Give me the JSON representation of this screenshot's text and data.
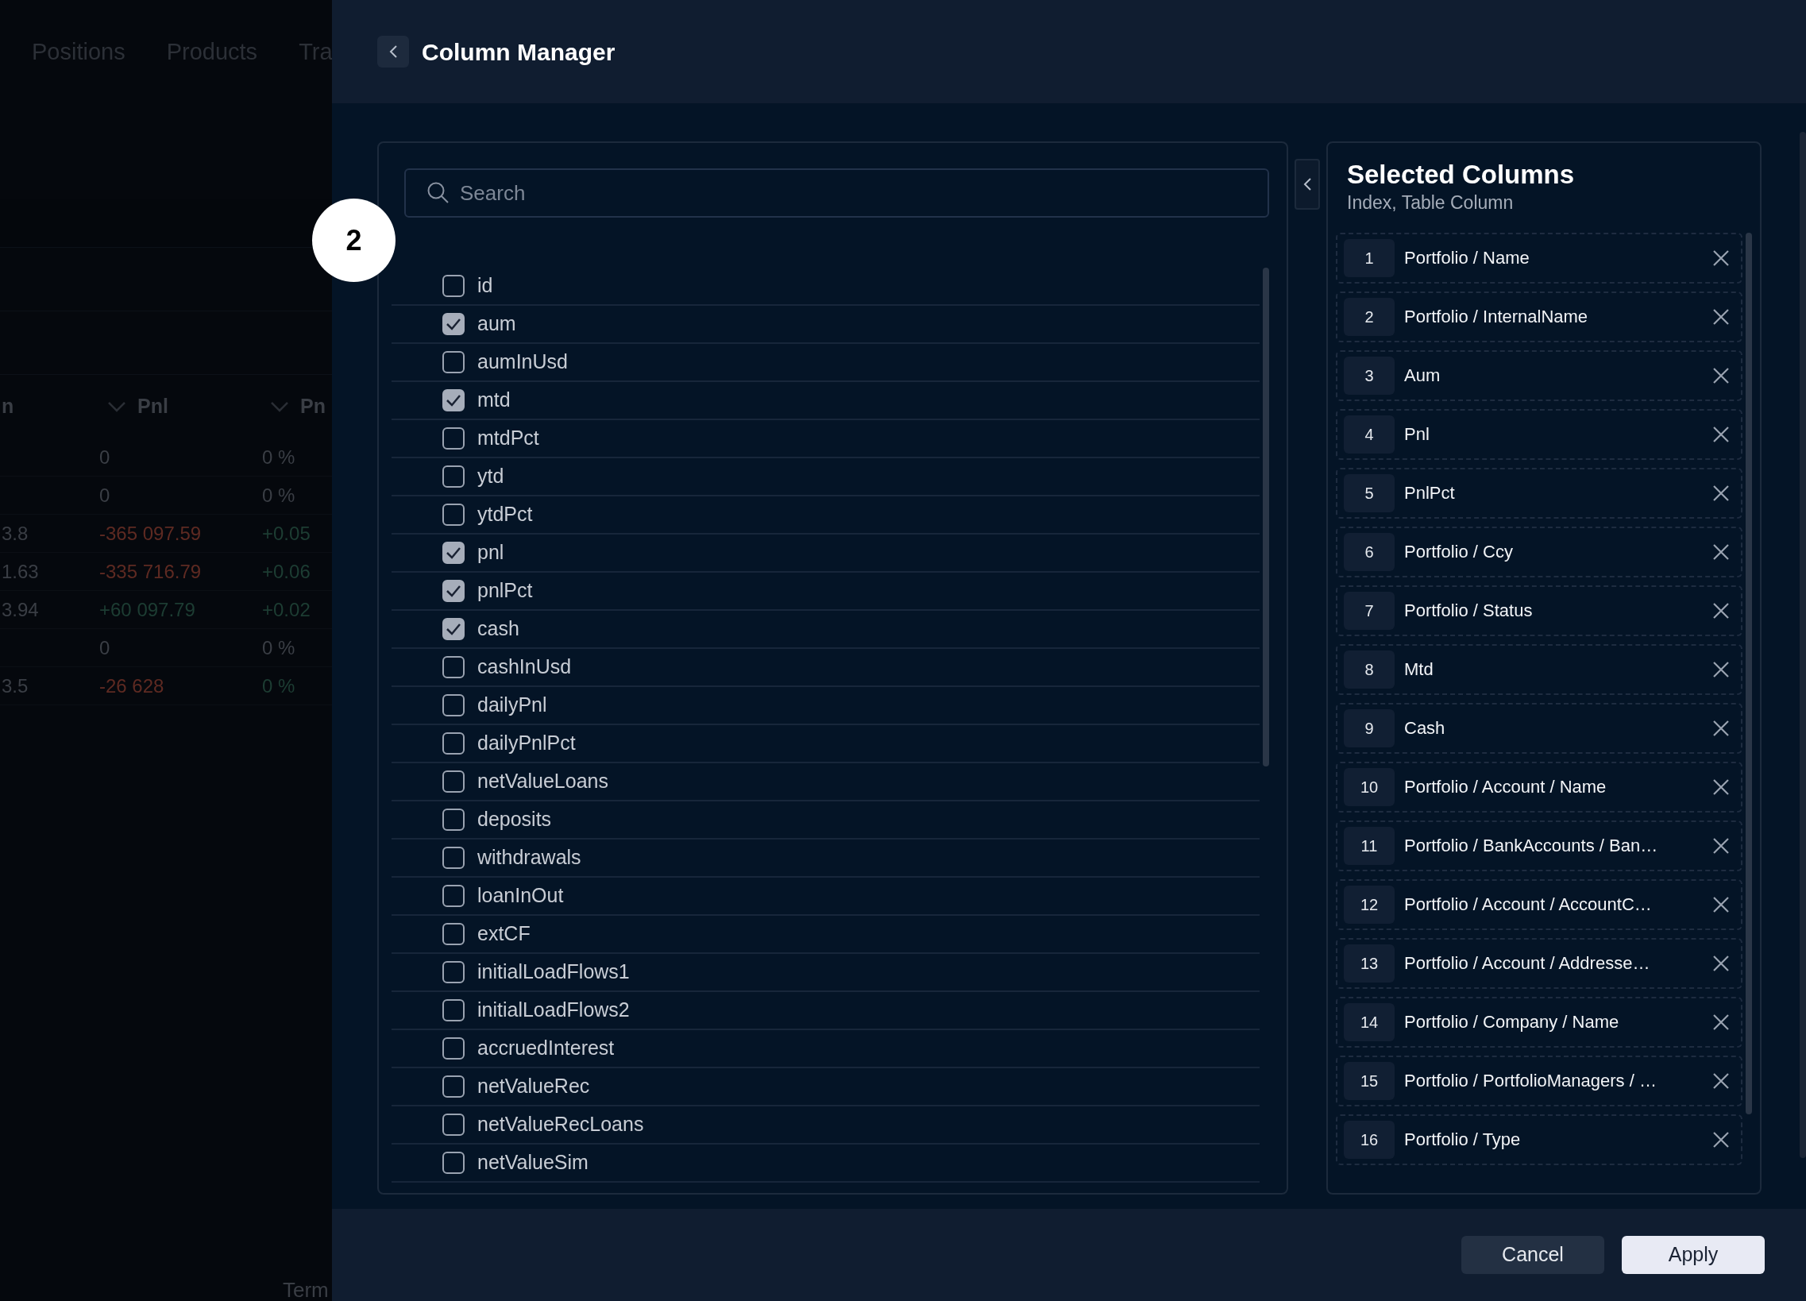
{
  "background": {
    "nav": [
      "Positions",
      "Products",
      "Tra"
    ],
    "table": {
      "columns": [
        {
          "label": "n",
          "chevron": false
        },
        {
          "label": "Pnl",
          "chevron": true
        },
        {
          "label": "Pn",
          "chevron": true
        }
      ],
      "rows": [
        {
          "pnl": {
            "text": "0",
            "kind": "neutral"
          },
          "pn": {
            "text": "0 %",
            "kind": "neutral"
          }
        },
        {
          "pnl": {
            "text": "0",
            "kind": "neutral"
          },
          "pn": {
            "text": "0 %",
            "kind": "neutral"
          }
        },
        {
          "column_1": {
            "text": "3.8",
            "kind": "neutral"
          },
          "pnl": {
            "text": "-365 097.59",
            "kind": "negative"
          },
          "pn": {
            "text": "+0.05",
            "kind": "positive"
          }
        },
        {
          "column_1": {
            "text": "1.63",
            "kind": "neutral"
          },
          "pnl": {
            "text": "-335 716.79",
            "kind": "negative"
          },
          "pn": {
            "text": "+0.06",
            "kind": "positive"
          }
        },
        {
          "column_1": {
            "text": "3.94",
            "kind": "neutral"
          },
          "pnl": {
            "text": "+60 097.79",
            "kind": "positive"
          },
          "pn": {
            "text": "+0.02",
            "kind": "positive"
          }
        },
        {
          "pnl": {
            "text": "0",
            "kind": "neutral"
          },
          "pn": {
            "text": "0 %",
            "kind": "neutral"
          }
        },
        {
          "column_1": {
            "text": "3.5",
            "kind": "neutral"
          },
          "pnl": {
            "text": "-26 628",
            "kind": "negative"
          },
          "pn": {
            "text": "0 %",
            "kind": "positive"
          }
        }
      ]
    },
    "footer_text": "Term"
  },
  "step_marker": "2",
  "drawer": {
    "title": "Column Manager",
    "search": {
      "placeholder": "Search"
    },
    "columns": [
      {
        "label": "id",
        "checked": false
      },
      {
        "label": "aum",
        "checked": true
      },
      {
        "label": "aumInUsd",
        "checked": false
      },
      {
        "label": "mtd",
        "checked": true
      },
      {
        "label": "mtdPct",
        "checked": false
      },
      {
        "label": "ytd",
        "checked": false
      },
      {
        "label": "ytdPct",
        "checked": false
      },
      {
        "label": "pnl",
        "checked": true
      },
      {
        "label": "pnlPct",
        "checked": true
      },
      {
        "label": "cash",
        "checked": true
      },
      {
        "label": "cashInUsd",
        "checked": false
      },
      {
        "label": "dailyPnl",
        "checked": false
      },
      {
        "label": "dailyPnlPct",
        "checked": false
      },
      {
        "label": "netValueLoans",
        "checked": false
      },
      {
        "label": "deposits",
        "checked": false
      },
      {
        "label": "withdrawals",
        "checked": false
      },
      {
        "label": "loanInOut",
        "checked": false
      },
      {
        "label": "extCF",
        "checked": false
      },
      {
        "label": "initialLoadFlows1",
        "checked": false
      },
      {
        "label": "initialLoadFlows2",
        "checked": false
      },
      {
        "label": "accruedInterest",
        "checked": false
      },
      {
        "label": "netValueRec",
        "checked": false
      },
      {
        "label": "netValueRecLoans",
        "checked": false
      },
      {
        "label": "netValueSim",
        "checked": false
      }
    ],
    "selected": {
      "title": "Selected Columns",
      "subtitle": "Index, Table Column",
      "items": [
        {
          "index": "1",
          "label": "Portfolio / Name"
        },
        {
          "index": "2",
          "label": "Portfolio / InternalName"
        },
        {
          "index": "3",
          "label": "Aum"
        },
        {
          "index": "4",
          "label": "Pnl"
        },
        {
          "index": "5",
          "label": "PnlPct"
        },
        {
          "index": "6",
          "label": "Portfolio / Ccy"
        },
        {
          "index": "7",
          "label": "Portfolio / Status"
        },
        {
          "index": "8",
          "label": "Mtd"
        },
        {
          "index": "9",
          "label": "Cash"
        },
        {
          "index": "10",
          "label": "Portfolio / Account / Name"
        },
        {
          "index": "11",
          "label": "Portfolio / BankAccounts / Ban…"
        },
        {
          "index": "12",
          "label": "Portfolio / Account / AccountC…"
        },
        {
          "index": "13",
          "label": "Portfolio / Account / Addresse…"
        },
        {
          "index": "14",
          "label": "Portfolio / Company / Name"
        },
        {
          "index": "15",
          "label": "Portfolio / PortfolioManagers / …"
        },
        {
          "index": "16",
          "label": "Portfolio / Type"
        }
      ]
    },
    "buttons": [
      {
        "label": "Cancel",
        "kind": "secondary"
      },
      {
        "label": "Apply",
        "kind": "primary"
      }
    ]
  }
}
